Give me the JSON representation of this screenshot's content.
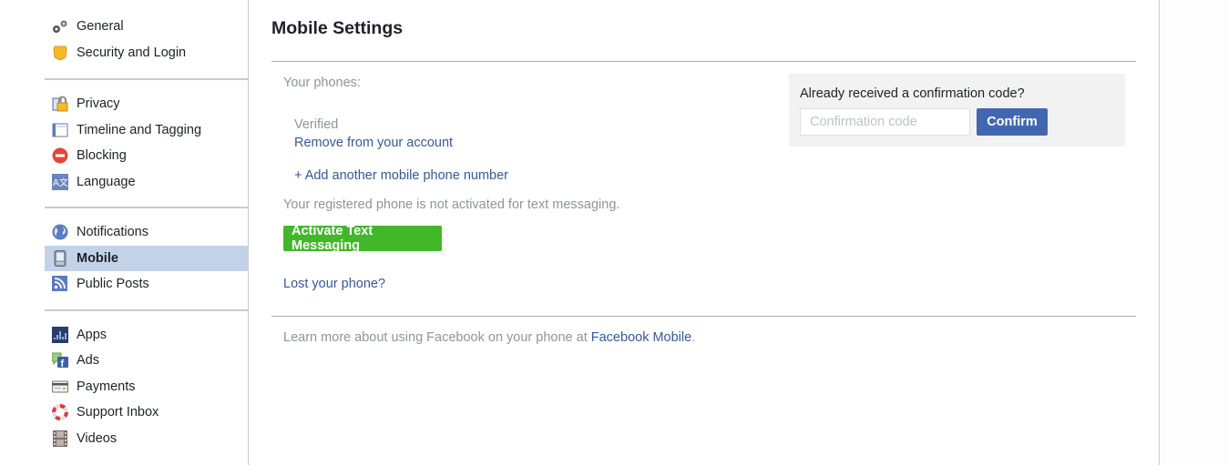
{
  "sidebar": {
    "groups": [
      [
        {
          "key": "general",
          "label": "General",
          "icon": "gears-icon"
        },
        {
          "key": "security",
          "label": "Security and Login",
          "icon": "shield-icon"
        }
      ],
      [
        {
          "key": "privacy",
          "label": "Privacy",
          "icon": "lock-icon"
        },
        {
          "key": "timeline",
          "label": "Timeline and Tagging",
          "icon": "timeline-icon"
        },
        {
          "key": "blocking",
          "label": "Blocking",
          "icon": "blocking-icon"
        },
        {
          "key": "language",
          "label": "Language",
          "icon": "language-icon"
        }
      ],
      [
        {
          "key": "notifications",
          "label": "Notifications",
          "icon": "globe-icon"
        },
        {
          "key": "mobile",
          "label": "Mobile",
          "icon": "mobile-phone-icon",
          "active": true
        },
        {
          "key": "public-posts",
          "label": "Public Posts",
          "icon": "rss-icon"
        }
      ],
      [
        {
          "key": "apps",
          "label": "Apps",
          "icon": "apps-icon"
        },
        {
          "key": "ads",
          "label": "Ads",
          "icon": "ads-icon"
        },
        {
          "key": "payments",
          "label": "Payments",
          "icon": "credit-card-icon"
        },
        {
          "key": "support-inbox",
          "label": "Support Inbox",
          "icon": "lifebuoy-icon"
        },
        {
          "key": "videos",
          "label": "Videos",
          "icon": "film-icon"
        }
      ]
    ]
  },
  "main": {
    "title": "Mobile Settings",
    "your_phones_label": "Your phones:",
    "phone_status": "Verified",
    "remove_link": "Remove from your account",
    "add_phone_link": "+ Add another mobile phone number",
    "not_activated_text": "Your registered phone is not activated for text messaging.",
    "activate_button": "Activate Text Messaging",
    "lost_phone_link": "Lost your phone?",
    "learn_more_text": "Learn more about using Facebook on your phone at ",
    "facebook_mobile_link": "Facebook Mobile",
    "learn_more_end": "."
  },
  "confirm": {
    "question": "Already received a confirmation code?",
    "placeholder": "Confirmation code",
    "value": "",
    "button": "Confirm"
  },
  "colors": {
    "link": "#365899",
    "active_bg": "#c4d2e7",
    "green": "#42b72a",
    "blue": "#4267b2"
  }
}
